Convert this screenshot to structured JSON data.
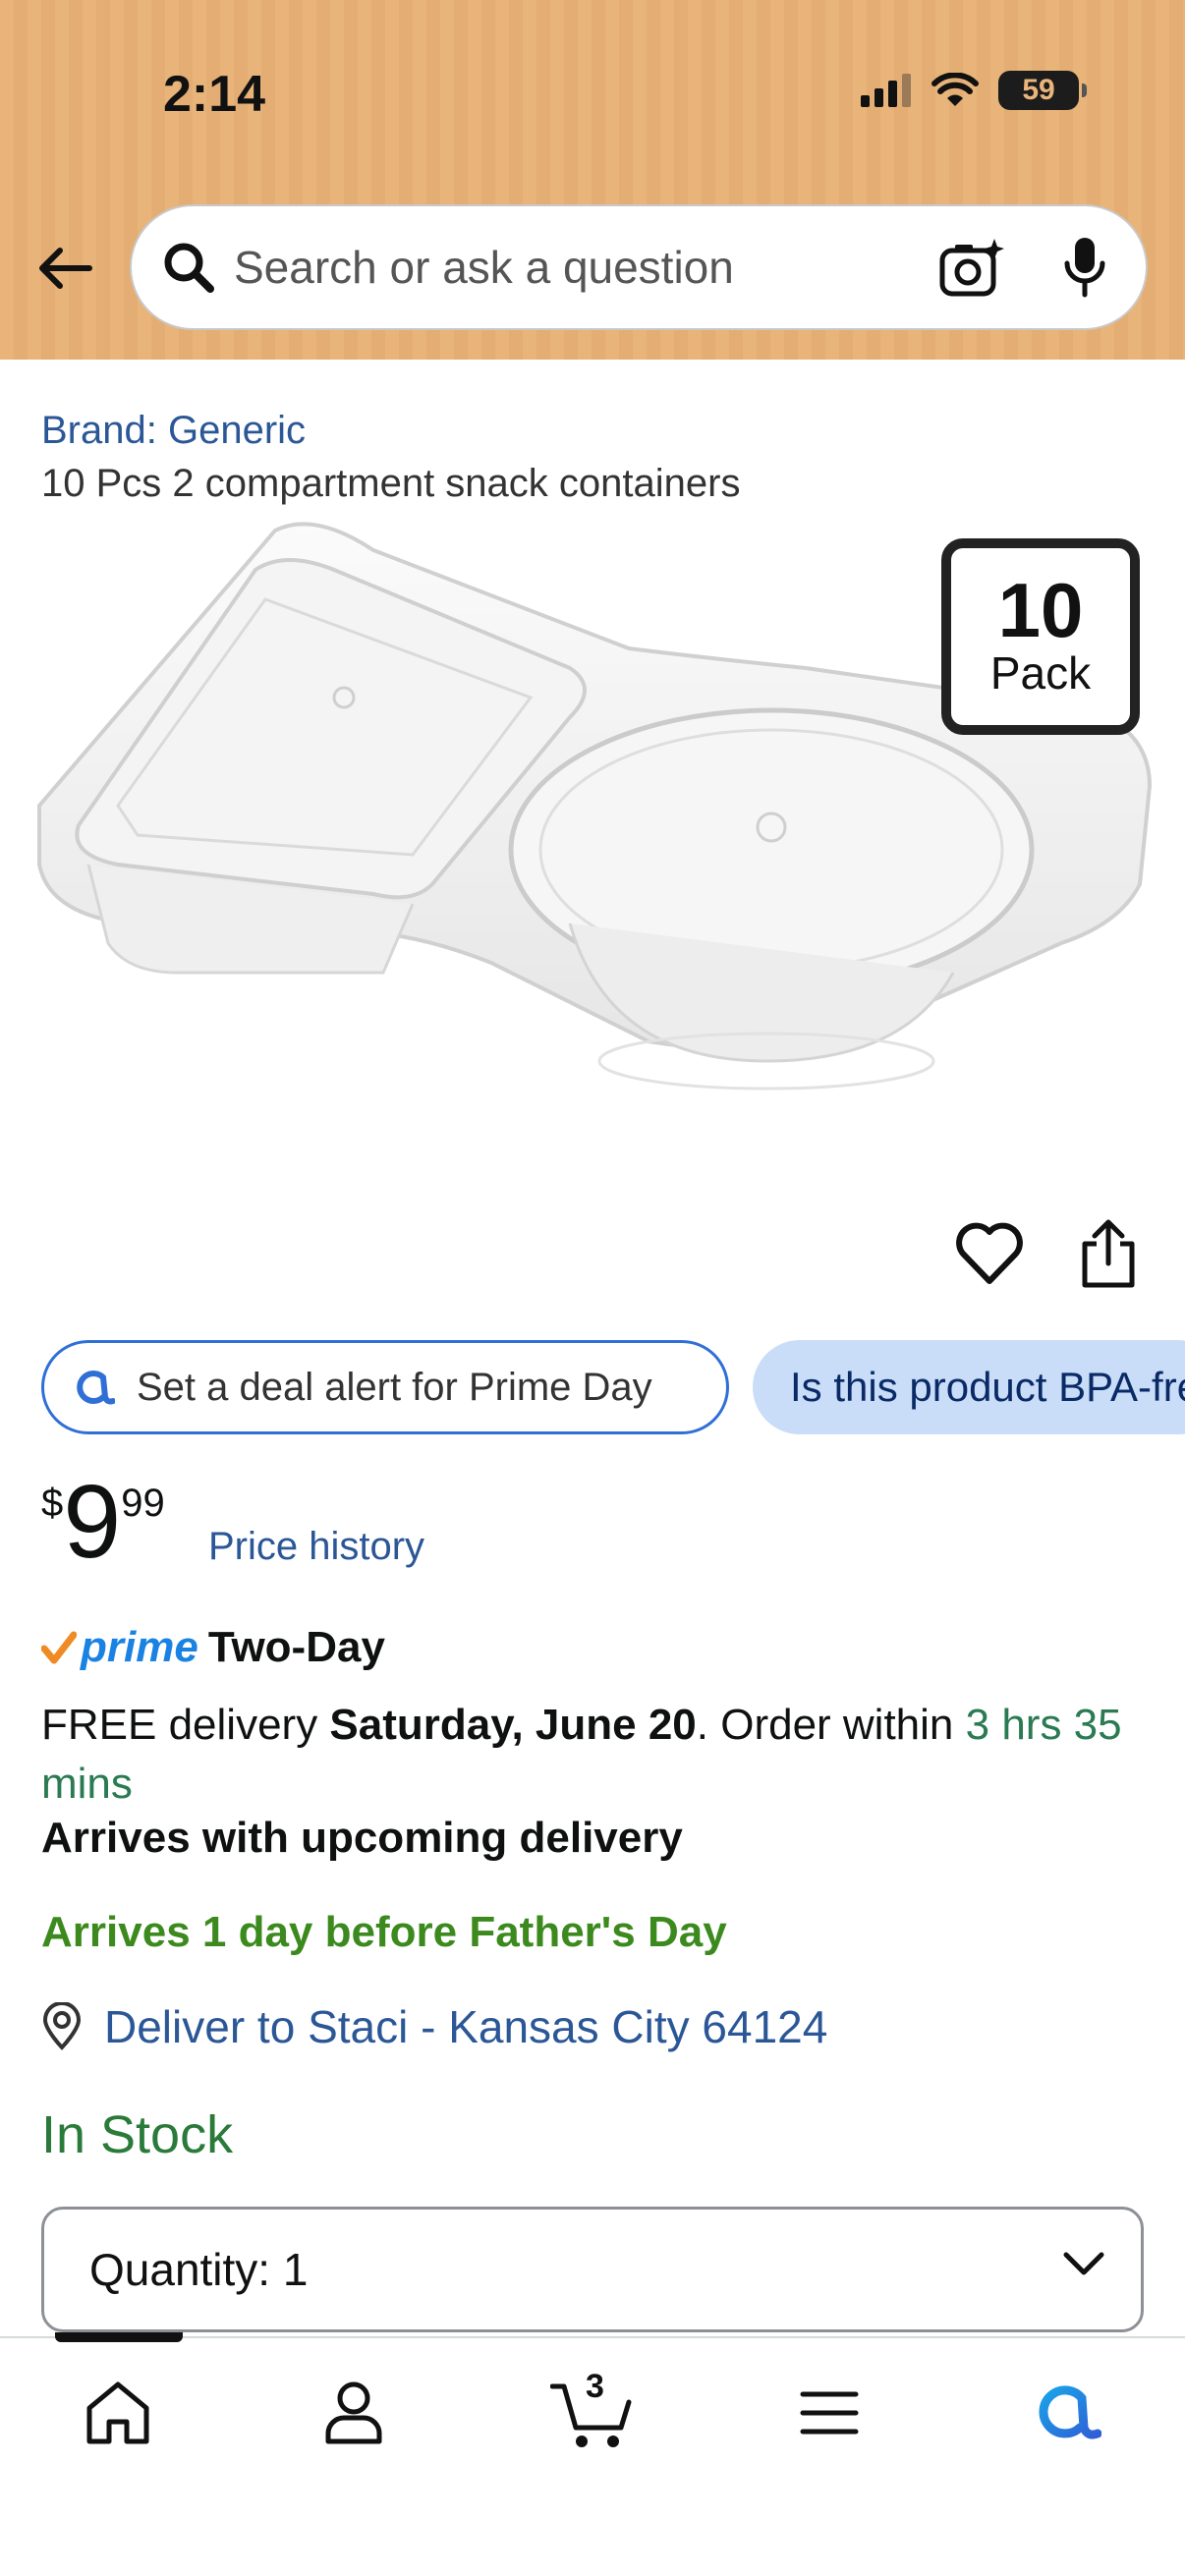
{
  "status_bar": {
    "time": "2:14",
    "battery": "59"
  },
  "search": {
    "placeholder": "Search or ask a question"
  },
  "product": {
    "brand": "Brand: Generic",
    "title": "10 Pcs 2 compartment snack containers",
    "badge_number": "10",
    "badge_word": "Pack"
  },
  "chips": {
    "deal_alert": "Set a deal alert for Prime Day",
    "bpa_question": "Is this product BPA-free?"
  },
  "price": {
    "symbol": "$",
    "whole": "9",
    "fraction": "99",
    "history_link": "Price history"
  },
  "shipping": {
    "prime_label": "prime",
    "prime_speed": "Two-Day",
    "free_delivery_prefix": "FREE delivery ",
    "delivery_date": "Saturday, June 20",
    "order_within_prefix": ". Order within ",
    "order_within_time": "3 hrs 35 mins",
    "arrives_note": "Arrives with upcoming delivery",
    "fathers_day_note": "Arrives 1 day before Father's Day",
    "deliver_to": "Deliver to Staci - Kansas City 64124"
  },
  "stock": {
    "status": "In Stock"
  },
  "quantity": {
    "label": "Quantity:",
    "value": "1"
  },
  "tabbar": {
    "cart_count": "3",
    "items": [
      "home-icon",
      "account-icon",
      "cart-icon",
      "menu-icon",
      "rufus-icon"
    ]
  },
  "colors": {
    "header_bg": "#e8b47a",
    "link_blue": "#2b5797",
    "stock_green": "#2a7a3a",
    "prime_blue": "#1a82e2",
    "chip_blue": "#c9ddf8"
  }
}
